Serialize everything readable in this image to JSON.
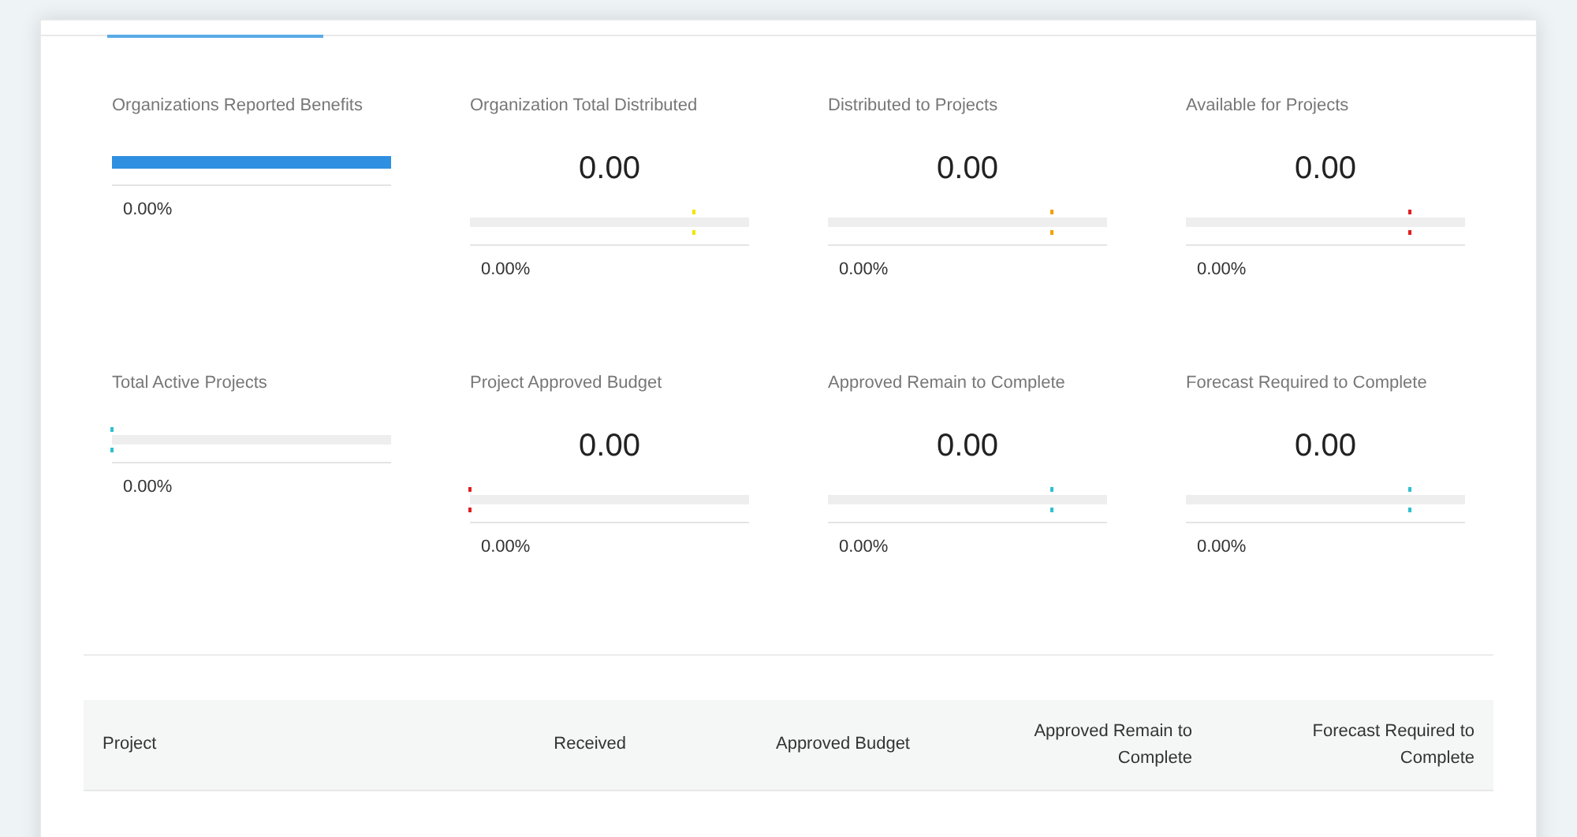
{
  "tabs": [
    {
      "selected": true
    }
  ],
  "metrics": [
    {
      "title": "Organizations Reported Benefits",
      "kind": "bar",
      "level": 1,
      "color": "#2f8fe0",
      "percent": "0.00%"
    },
    {
      "title": "Organization Total Distributed",
      "value": "0.00",
      "kind": "tick",
      "level": 0.8,
      "color": "#f2e600",
      "percent": "0.00%"
    },
    {
      "title": "Distributed to Projects",
      "value": "0.00",
      "kind": "tick",
      "level": 0.8,
      "color": "#f5a000",
      "percent": "0.00%"
    },
    {
      "title": "Available for Projects",
      "value": "0.00",
      "kind": "tick",
      "level": 0.8,
      "color": "#e02020",
      "percent": "0.00%"
    },
    {
      "title": "Total Active Projects",
      "kind": "tick",
      "level": 0,
      "color": "#30c0d0",
      "percent": "0.00%"
    },
    {
      "title": "Project Approved Budget",
      "value": "0.00",
      "kind": "tick",
      "level": 0,
      "color": "#e02020",
      "percent": "0.00%"
    },
    {
      "title": "Approved Remain to Complete",
      "value": "0.00",
      "kind": "tick",
      "level": 0.8,
      "color": "#30c0d0",
      "percent": "0.00%"
    },
    {
      "title": "Forecast Required to Complete",
      "value": "0.00",
      "kind": "tick",
      "level": 0.8,
      "color": "#30c0d0",
      "percent": "0.00%"
    }
  ],
  "table": {
    "columns": [
      "Project",
      "Received",
      "Approved Budget",
      "Approved Remain to Complete",
      "Forecast Required to Complete"
    ]
  }
}
